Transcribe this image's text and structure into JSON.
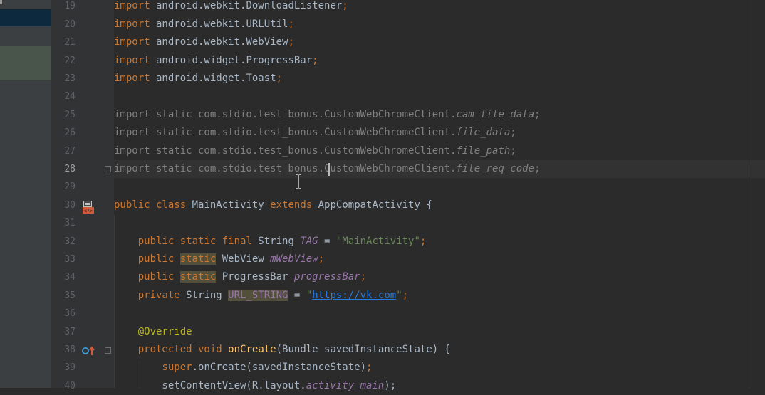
{
  "editor": {
    "lines": [
      {
        "num": "19",
        "cur": false,
        "segs": [
          {
            "t": "import",
            "c": "kw"
          },
          {
            "t": " android.webkit.DownloadListener"
          },
          {
            "t": ";",
            "c": "kw"
          }
        ]
      },
      {
        "num": "20",
        "cur": false,
        "segs": [
          {
            "t": "import",
            "c": "kw"
          },
          {
            "t": " android.webkit.URLUtil"
          },
          {
            "t": ";",
            "c": "kw"
          }
        ]
      },
      {
        "num": "21",
        "cur": false,
        "segs": [
          {
            "t": "import",
            "c": "kw"
          },
          {
            "t": " android.webkit.WebView"
          },
          {
            "t": ";",
            "c": "kw"
          }
        ]
      },
      {
        "num": "22",
        "cur": false,
        "segs": [
          {
            "t": "import",
            "c": "kw"
          },
          {
            "t": " android.widget.ProgressBar"
          },
          {
            "t": ";",
            "c": "kw"
          }
        ]
      },
      {
        "num": "23",
        "cur": false,
        "segs": [
          {
            "t": "import",
            "c": "kw"
          },
          {
            "t": " android.widget.Toast"
          },
          {
            "t": ";",
            "c": "kw"
          }
        ]
      },
      {
        "num": "24",
        "cur": false,
        "segs": []
      },
      {
        "num": "25",
        "cur": false,
        "segs": [
          {
            "t": "import static com.stdio.test_bonus.CustomWebChromeClient.",
            "c": "gray"
          },
          {
            "t": "cam_file_data",
            "c": "gray it"
          },
          {
            "t": ";",
            "c": "gray"
          }
        ]
      },
      {
        "num": "26",
        "cur": false,
        "segs": [
          {
            "t": "import static com.stdio.test_bonus.CustomWebChromeClient.",
            "c": "gray"
          },
          {
            "t": "file_data",
            "c": "gray it"
          },
          {
            "t": ";",
            "c": "gray"
          }
        ]
      },
      {
        "num": "27",
        "cur": false,
        "segs": [
          {
            "t": "import static com.stdio.test_bonus.CustomWebChromeClient.",
            "c": "gray"
          },
          {
            "t": "file_path",
            "c": "gray it"
          },
          {
            "t": ";",
            "c": "gray"
          }
        ]
      },
      {
        "num": "28",
        "cur": true,
        "segs": [
          {
            "t": "import static com.stdio.test_bonus.CustomWebChromeClient.",
            "c": "gray"
          },
          {
            "t": "file_req_code",
            "c": "gray it"
          },
          {
            "t": ";",
            "c": "gray"
          }
        ]
      },
      {
        "num": "29",
        "cur": false,
        "segs": []
      },
      {
        "num": "30",
        "cur": false,
        "segs": [
          {
            "t": "public class",
            "c": "kw"
          },
          {
            "t": " MainActivity "
          },
          {
            "t": "extends",
            "c": "kw"
          },
          {
            "t": " AppCompatActivity {"
          }
        ]
      },
      {
        "num": "31",
        "cur": false,
        "segs": []
      },
      {
        "num": "32",
        "cur": false,
        "segs": [
          {
            "t": "    "
          },
          {
            "t": "public static final",
            "c": "kw"
          },
          {
            "t": " String "
          },
          {
            "t": "TAG",
            "c": "purple it"
          },
          {
            "t": " = "
          },
          {
            "t": "\"MainActivity\"",
            "c": "str"
          },
          {
            "t": ";",
            "c": "kw"
          }
        ]
      },
      {
        "num": "33",
        "cur": false,
        "segs": [
          {
            "t": "    "
          },
          {
            "t": "public",
            "c": "kw"
          },
          {
            "t": " "
          },
          {
            "t": "static",
            "c": "kw hlbg"
          },
          {
            "t": " WebView "
          },
          {
            "t": "mWebView",
            "c": "purple it"
          },
          {
            "t": ";",
            "c": "kw"
          }
        ]
      },
      {
        "num": "34",
        "cur": false,
        "segs": [
          {
            "t": "    "
          },
          {
            "t": "public",
            "c": "kw"
          },
          {
            "t": " "
          },
          {
            "t": "static",
            "c": "kw hlbg"
          },
          {
            "t": " ProgressBar "
          },
          {
            "t": "progressBar",
            "c": "purple it"
          },
          {
            "t": ";",
            "c": "kw"
          }
        ]
      },
      {
        "num": "35",
        "cur": false,
        "segs": [
          {
            "t": "    "
          },
          {
            "t": "private",
            "c": "kw"
          },
          {
            "t": " String "
          },
          {
            "t": "URL_STRING",
            "c": "purple hlbg"
          },
          {
            "t": " = "
          },
          {
            "t": "\"",
            "c": "str"
          },
          {
            "t": "https://vk.com",
            "c": "link"
          },
          {
            "t": "\"",
            "c": "str"
          },
          {
            "t": ";",
            "c": "kw"
          }
        ]
      },
      {
        "num": "36",
        "cur": false,
        "segs": []
      },
      {
        "num": "37",
        "cur": false,
        "segs": [
          {
            "t": "    "
          },
          {
            "t": "@Override",
            "c": "ann"
          }
        ]
      },
      {
        "num": "38",
        "cur": false,
        "segs": [
          {
            "t": "    "
          },
          {
            "t": "protected void",
            "c": "kw"
          },
          {
            "t": " "
          },
          {
            "t": "onCreate",
            "c": "fn"
          },
          {
            "t": "(Bundle savedInstanceState) {"
          }
        ]
      },
      {
        "num": "39",
        "cur": false,
        "segs": [
          {
            "t": "        "
          },
          {
            "t": "super",
            "c": "kw"
          },
          {
            "t": ".onCreate(savedInstanceState)"
          },
          {
            "t": ";",
            "c": "kw"
          }
        ]
      },
      {
        "num": "40",
        "cur": false,
        "segs": [
          {
            "t": "        setContentView(R.layout."
          },
          {
            "t": "activity_main",
            "c": "purple it"
          },
          {
            "t": ");"
          }
        ]
      }
    ]
  },
  "icons": {
    "class_gutter": "android-activity-class-icon",
    "override_gutter": "overrides-method-icon",
    "fold": "fold-marker-icon",
    "cursor": "text-cursor-ibeam-icon"
  }
}
